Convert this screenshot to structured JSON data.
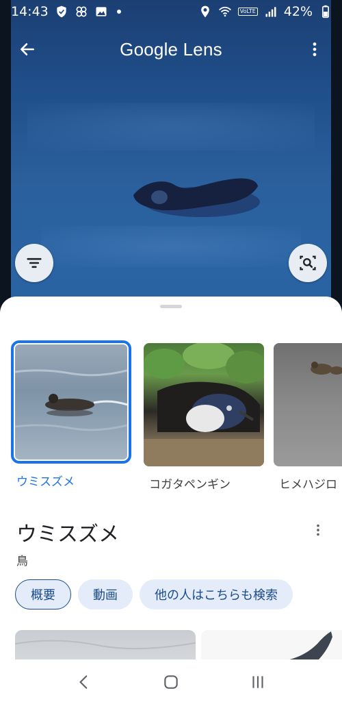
{
  "status_bar": {
    "time": "14:43",
    "battery": "42%",
    "volte": "VoLTE"
  },
  "header": {
    "title": "Google Lens",
    "back_icon": "arrow-back-icon",
    "menu_icon": "more-vert-icon"
  },
  "photo_controls": {
    "filter_icon": "filter-icon",
    "crop_search_icon": "image-search-icon"
  },
  "carousel": {
    "items": [
      {
        "label": "ウミスズメ",
        "selected": true
      },
      {
        "label": "コガタペンギン",
        "selected": false
      },
      {
        "label": "ヒメハジロ",
        "selected": false
      }
    ]
  },
  "result": {
    "title": "ウミスズメ",
    "subtitle": "鳥"
  },
  "chips": [
    {
      "label": "概要",
      "active": true
    },
    {
      "label": "動画",
      "active": false
    },
    {
      "label": "他の人はこちらも検索",
      "active": false
    }
  ],
  "colors": {
    "accent": "#1a73e8",
    "chip_bg": "#e3ecf8",
    "chip_text": "#1a4b8e"
  }
}
